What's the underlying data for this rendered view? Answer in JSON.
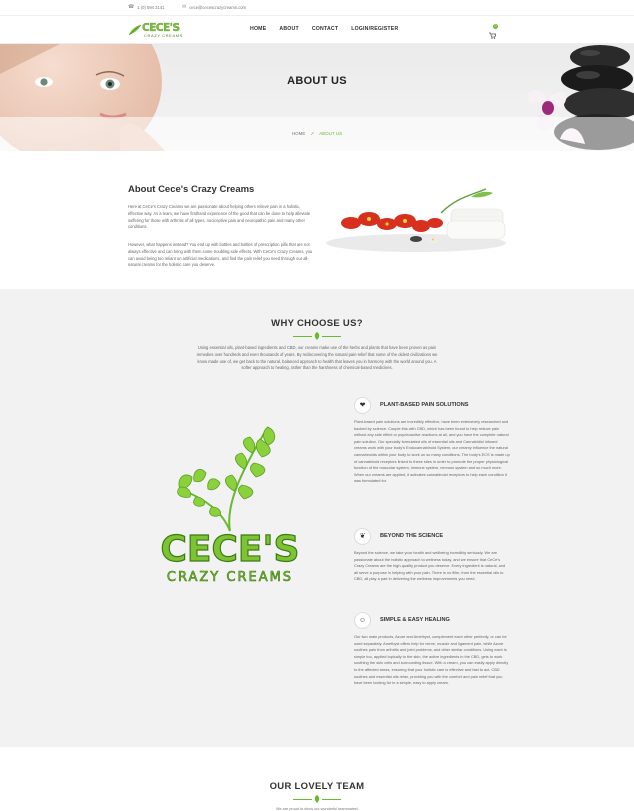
{
  "topbar": {
    "phone": "1 (0) 594 3141",
    "email": "cece@cecescrazycreams.com"
  },
  "logo": {
    "line1": "CECE'S",
    "line2": "CRAZY CREAMS"
  },
  "nav": {
    "home": "HOME",
    "about": "ABOUT",
    "contact": "CONTACT",
    "login": "LOGIN/REGISTER"
  },
  "cart": {
    "count": "0"
  },
  "banner": {
    "title": "ABOUT US",
    "crumb_home": "HOME",
    "crumb_current": "ABOUT US"
  },
  "about": {
    "heading": "About Cece's Crazy Creams",
    "p1": "Here at CeCe's Crazy Creams we are passionate about helping others relieve pain in a holistic, effective way. As a team, we have firsthand experience of the good that can be done to help alleviate suffering for those with arthritis of all types, nociceptive pain and neuropathic pain and many other conditions.",
    "p2": "However, what happens instead? You end up with bottles and bottles of prescription pills that are not always effective and can bring with them some troubling side effects. With CeCe's Crazy Creams, you can avoid being too reliant on artificial medications, and find the pain relief you need through our all-natural creams for the holistic care you deserve."
  },
  "why": {
    "heading": "WHY CHOOSE US?",
    "intro": "Using essential oils, plant-based ingredients and CBD, our creams make use of the herbs and plants that have been proven as pain remedies over hundreds and even thousands of years. By rediscovering the natural pain-relief that some of the oldest civilizations we know made use of, we get back to the natural, balanced approach to health that leaves you in harmony with the world around you. A softer approach to healing, rather than the harshness of chemical-based medicines.",
    "big_logo_line1": "CECE'S",
    "big_logo_line2": "CRAZY CREAMS",
    "features": [
      {
        "title": "PLANT-BASED PAIN SOLUTIONS",
        "icon": "heart-icon",
        "text": "Plant-based pain solutions are incredibly effective, have been extensively researched and backed by science. Couple this with CBD, which has been found to help reduce pain without any side effect or psychoactive reactions at all, and you have the complete natural pain solution. Our specially formulated oils of essential oils and Cannabidiol infused creams work with your body's Endocannabinoid System, our creamy influence the natural cannabinoids within your body to work on so many conditions. The body's ECS is made up of cannabinoid receptors linked to these sites in order to promote the proper physiological function of the muscular system, immune system, nervous system and so much more. When our creams are applied, it activates cannabinoid receptors to help each condition it was formulated for."
      },
      {
        "title": "BEYOND THE SCIENCE",
        "icon": "leaf-icon",
        "text": "Beyond the science, we take your health and wellbeing incredibly seriously. We are passionate about the holistic approach to wellness today, and we ensure that CeCe's Crazy Creams are the high-quality product you deserve. Every ingredient is natural, and all serve a purpose in helping with your pain. There is no filler, from the essential oils to CBD, all play a part in delivering the wellness improvements you need."
      },
      {
        "title": "SIMPLE & EASY HEALING",
        "icon": "smile-icon",
        "text": "Our two main products, Azure and Amethyst, complement each other perfectly, or can be used separately. Amethyst offers help for nerve, muscle and ligament pain, while Azure soothes pain from arthritis and joint problems, and other similar conditions. Using each is simple too, applied topically to the skin, the active ingredients in the CBD, gets to work soothing the skin cells and surrounding tissue. With a cream, you can easily apply directly to the affected areas, ensuring that your holistic care is effective and fast to act. CBD soothes and essential oils relax, providing you with the comfort and pain relief that you have been looking for in a simple, easy to apply cream."
      }
    ]
  },
  "team": {
    "heading": "OUR LOVELY TEAM",
    "sub": "We are proud to show our wonderful teammates!"
  },
  "colors": {
    "accent": "#6cb832",
    "dark_green": "#4a8a1c",
    "section_bg": "#f2f2f2"
  }
}
